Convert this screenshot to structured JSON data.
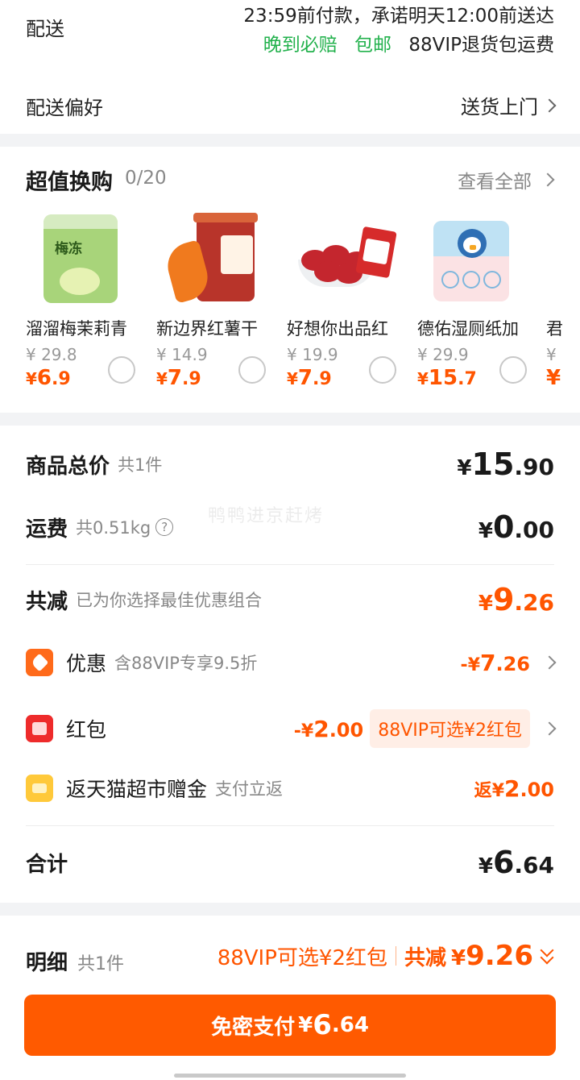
{
  "delivery": {
    "label": "配送",
    "promise": "23:59前付款，承诺明天12:00前送达",
    "tag_late": "晚到必赔",
    "tag_free": "包邮",
    "tag_vip": "88VIP退货包运费",
    "pref_label": "配送偏好",
    "pref_value": "送货上门"
  },
  "exchange": {
    "title": "超值换购",
    "count": "0/20",
    "view_all": "查看全部",
    "items": [
      {
        "name": "溜溜梅茉莉青",
        "orig": "¥ 29.8",
        "price_int": "6",
        "price_dec": ".9"
      },
      {
        "name": "新边界红薯干",
        "orig": "¥ 14.9",
        "price_int": "7",
        "price_dec": ".9"
      },
      {
        "name": "好想你出品红",
        "orig": "¥ 19.9",
        "price_int": "7",
        "price_dec": ".9"
      },
      {
        "name": "德佑湿厕纸加",
        "orig": "¥ 29.9",
        "price_int": "15",
        "price_dec": ".7"
      }
    ],
    "partial_name": "君",
    "partial_orig": "¥",
    "partial_price": "¥",
    "product_label_1": "梅冻",
    "currency": "¥"
  },
  "summary": {
    "goods_label": "商品总价",
    "goods_sub": "共1件",
    "goods_int": "15",
    "goods_dec": ".90",
    "ship_label": "运费",
    "ship_sub": "共0.51kg",
    "ship_int": "0",
    "ship_dec": ".00",
    "watermark": "鸭鸭进京赶烤",
    "reduce_label": "共减",
    "reduce_sub": "已为你选择最佳优惠组合",
    "reduce_int": "9",
    "reduce_dec": ".26",
    "promo_label": "优惠",
    "promo_sub": "含88VIP专享9.5折",
    "promo_minus": "-",
    "promo_int": "7",
    "promo_dec": ".26",
    "hongbao_label": "红包",
    "hongbao_minus": "-",
    "hongbao_int": "2",
    "hongbao_dec": ".00",
    "hongbao_tag": "88VIP可选¥2红包",
    "rebate_label": "返天猫超市赠金",
    "rebate_sub": "支付立返",
    "rebate_prefix": "返",
    "rebate_int": "2",
    "rebate_dec": ".00",
    "total_label": "合计",
    "total_int": "6",
    "total_dec": ".64",
    "currency": "¥",
    "qmark": "?"
  },
  "bottom": {
    "label": "明细",
    "count": "共1件",
    "tag": "88VIP可选¥2红包",
    "reduce_label": "共减",
    "reduce_amount": "9.26",
    "pay_label": "免密支付",
    "pay_int": "6",
    "pay_dec": ".64",
    "currency": "¥"
  },
  "colors": {
    "accent": "#ff5500",
    "green": "#22b14c",
    "pay_button": "#ff5a00"
  },
  "icons": [
    "chevron-right-icon",
    "radio-icon",
    "question-icon",
    "coupon-tag-icon",
    "red-packet-icon",
    "gift-icon",
    "double-chevron-down-icon"
  ]
}
